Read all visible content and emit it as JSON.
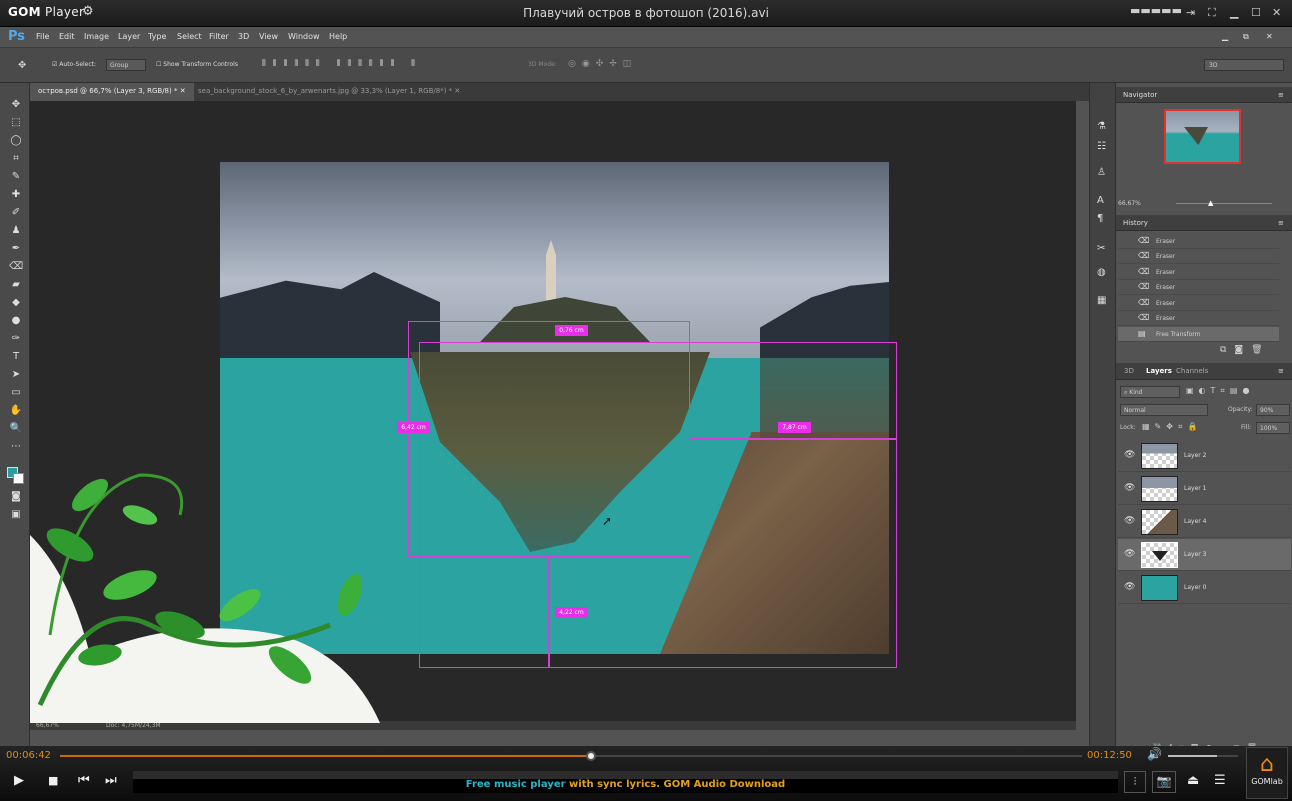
{
  "player": {
    "brand": "GOM",
    "brand_suffix": "Player",
    "title": "Плавучий остров в фотошоп (2016).avi",
    "current_time": "00:06:42",
    "total_time": "00:12:50",
    "progress": 0.52,
    "volume": 0.7,
    "banner_part1": "Free music player",
    "banner_part2": " with sync lyrics. GOM Audio Download",
    "gomlab_label": "GOMlab",
    "accent": "#e08a1a"
  },
  "ps": {
    "logo": "Ps",
    "menu": [
      "File",
      "Edit",
      "Image",
      "Layer",
      "Type",
      "Select",
      "Filter",
      "3D",
      "View",
      "Window",
      "Help"
    ],
    "options": {
      "auto_select": "Auto-Select:",
      "group": "Group",
      "show_transform": "Show Transform Controls",
      "mode_3d": "3D Mode:",
      "workspace": "3D"
    },
    "tabs": [
      "остров.psd @ 66,7% (Layer 3, RGB/8) *",
      "sea_background_stock_6_by_arwenarts.jpg @ 33,3% (Layer 1, RGB/8*) *"
    ],
    "status": {
      "zoom": "66,67%",
      "doc": "Doc: 4,75M/24,3M"
    },
    "measures": [
      "0,76 cm",
      "6,42 cm",
      "7,87 cm",
      "4,22 cm"
    ],
    "navigator": {
      "title": "Navigator",
      "zoom": "66,67%"
    },
    "history": {
      "title": "History",
      "items": [
        "Eraser",
        "Eraser",
        "Eraser",
        "Eraser",
        "Eraser",
        "Eraser",
        "Free Transform"
      ]
    },
    "layers_panel": {
      "tabs": [
        "3D",
        "Layers",
        "Channels"
      ],
      "kind": "Kind",
      "blend": "Normal",
      "opacity_label": "Opacity:",
      "opacity": "90%",
      "lock_label": "Lock:",
      "fill_label": "Fill:",
      "fill": "100%",
      "layers": [
        "Layer 2",
        "Layer 1",
        "Layer 4",
        "Layer 3",
        "Layer 0"
      ]
    }
  }
}
